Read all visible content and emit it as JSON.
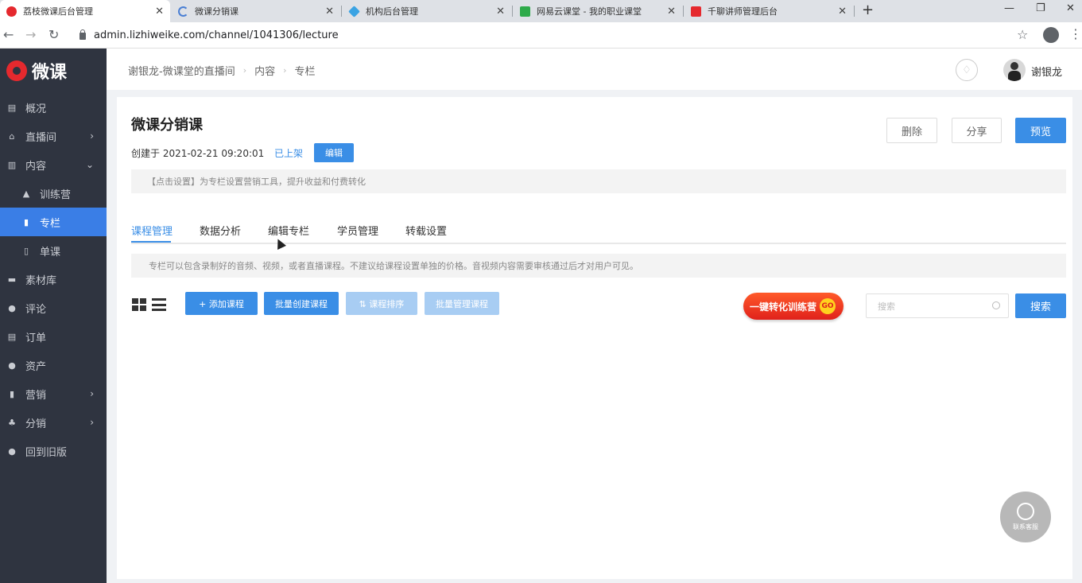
{
  "browser": {
    "tabs": [
      {
        "title": "荔枝微课后台管理",
        "active": true,
        "favicon_color": "#e5292e"
      },
      {
        "title": "微课分销课",
        "active": false,
        "favicon_color": "#4a7fd4"
      },
      {
        "title": "机构后台管理",
        "active": false,
        "favicon_color": "#3aa3e3"
      },
      {
        "title": "网易云课堂 - 我的职业课堂",
        "active": false,
        "favicon_color": "#2eaa4a"
      },
      {
        "title": "千聊讲师管理后台",
        "active": false,
        "favicon_color": "#e5292e"
      }
    ],
    "url": "admin.lizhiweike.com/channel/1041306/lecture"
  },
  "sidebar": {
    "logo_text": "微课",
    "items": [
      {
        "label": "概况",
        "icon": "chart-icon",
        "glyph": "▤",
        "sub": false,
        "active": false,
        "arrow": ""
      },
      {
        "label": "直播间",
        "icon": "home-icon",
        "glyph": "⌂",
        "sub": false,
        "active": false,
        "arrow": "›"
      },
      {
        "label": "内容",
        "icon": "book-icon",
        "glyph": "▥",
        "sub": false,
        "active": false,
        "arrow": "⌄"
      },
      {
        "label": "训练营",
        "icon": "triangle-icon",
        "glyph": "▲",
        "sub": true,
        "active": false,
        "arrow": ""
      },
      {
        "label": "专栏",
        "icon": "bookmark-icon",
        "glyph": "▮",
        "sub": true,
        "active": true,
        "arrow": ""
      },
      {
        "label": "单课",
        "icon": "document-icon",
        "glyph": "▯",
        "sub": true,
        "active": false,
        "arrow": ""
      },
      {
        "label": "素材库",
        "icon": "folder-icon",
        "glyph": "▬",
        "sub": false,
        "active": false,
        "arrow": ""
      },
      {
        "label": "评论",
        "icon": "comment-icon",
        "glyph": "●",
        "sub": false,
        "active": false,
        "arrow": ""
      },
      {
        "label": "订单",
        "icon": "clipboard-icon",
        "glyph": "▤",
        "sub": false,
        "active": false,
        "arrow": ""
      },
      {
        "label": "资产",
        "icon": "coin-icon",
        "glyph": "●",
        "sub": false,
        "active": false,
        "arrow": ""
      },
      {
        "label": "营销",
        "icon": "bar-chart-icon",
        "glyph": "▮",
        "sub": false,
        "active": false,
        "arrow": "›"
      },
      {
        "label": "分销",
        "icon": "org-chart-icon",
        "glyph": "♣",
        "sub": false,
        "active": false,
        "arrow": "›"
      },
      {
        "label": "回到旧版",
        "icon": "back-icon",
        "glyph": "●",
        "sub": false,
        "active": false,
        "arrow": ""
      }
    ]
  },
  "topbar": {
    "breadcrumb": [
      "谢银龙-微课堂的直播间",
      "内容",
      "专栏"
    ],
    "username": "谢银龙"
  },
  "course": {
    "title": "微课分销课",
    "created": "创建于 2021-02-21 09:20:01",
    "status": "已上架",
    "edit_label": "编辑",
    "delete_label": "删除",
    "share_label": "分享",
    "preview_label": "预览",
    "tip_marketing": "【点击设置】为专栏设置营销工具，提升收益和付费转化"
  },
  "page_tabs": [
    "课程管理",
    "数据分析",
    "编辑专栏",
    "学员管理",
    "转载设置"
  ],
  "tip_content": "专栏可以包含录制好的音频、视频，或者直播课程。不建议给课程设置单独的价格。音视频内容需要审核通过后才对用户可见。",
  "actions": {
    "add_course": "+ 添加课程",
    "batch_create": "批量创建课程",
    "sort": "⇅ 课程排序",
    "batch_manage": "批量管理课程",
    "promo": "一键转化训练营",
    "promo_go": "GO",
    "search_placeholder": "搜索",
    "search_btn": "搜索"
  },
  "kefu_label": "联系客服",
  "colors": {
    "accent": "#3a8ee6",
    "sidebar_bg": "#2f3440",
    "promo_red": "#e0211b"
  }
}
